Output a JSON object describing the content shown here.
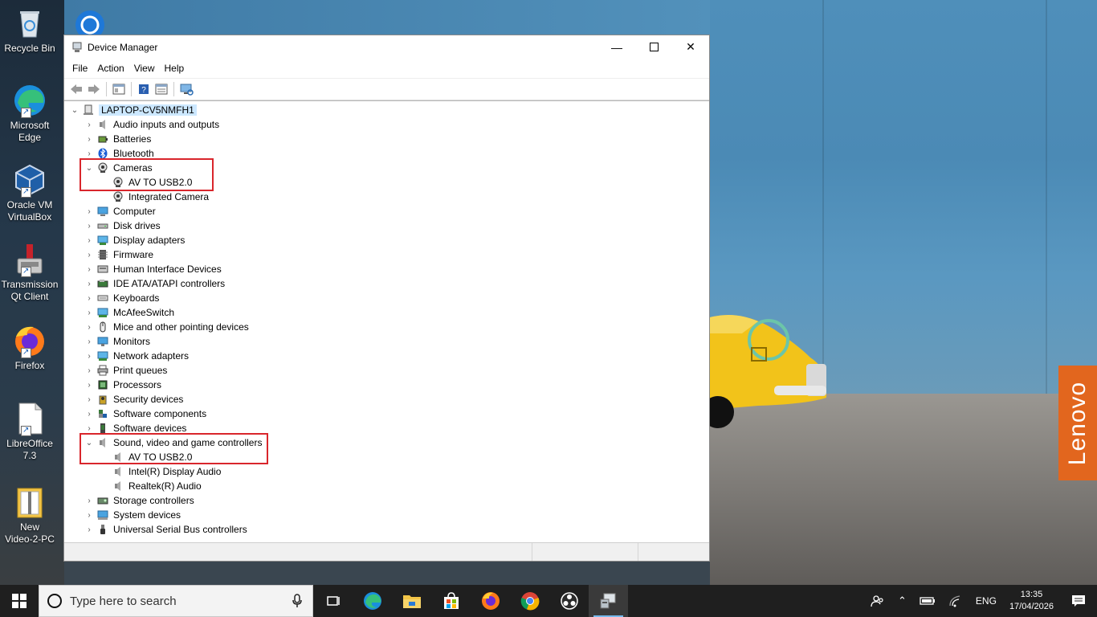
{
  "desktop": {
    "icons": [
      {
        "label_line1": "Recycle Bin",
        "label_line2": ""
      },
      {
        "label_line1": "Microsoft",
        "label_line2": "Edge"
      },
      {
        "label_line1": "Oracle VM",
        "label_line2": "VirtualBox"
      },
      {
        "label_line1": "Transmission",
        "label_line2": "Qt Client"
      },
      {
        "label_line1": "Firefox",
        "label_line2": ""
      },
      {
        "label_line1": "LibreOffice",
        "label_line2": "7.3"
      },
      {
        "label_line1": "New",
        "label_line2": "Video-2-PC"
      }
    ],
    "brand_label": "Lenovo"
  },
  "window": {
    "title": "Device Manager",
    "menu": [
      "File",
      "Action",
      "View",
      "Help"
    ],
    "tree": {
      "root": "LAPTOP-CV5NMFH1",
      "categories": [
        {
          "label": "Audio inputs and outputs",
          "icon": "speaker-icon",
          "expanded": false
        },
        {
          "label": "Batteries",
          "icon": "battery-icon",
          "expanded": false
        },
        {
          "label": "Bluetooth",
          "icon": "bluetooth-icon",
          "expanded": false
        },
        {
          "label": "Cameras",
          "icon": "camera-icon",
          "expanded": true,
          "children": [
            "AV TO USB2.0",
            "Integrated Camera"
          ]
        },
        {
          "label": "Computer",
          "icon": "computer-icon",
          "expanded": false
        },
        {
          "label": "Disk drives",
          "icon": "disk-icon",
          "expanded": false
        },
        {
          "label": "Display adapters",
          "icon": "display-adapter-icon",
          "expanded": false
        },
        {
          "label": "Firmware",
          "icon": "firmware-icon",
          "expanded": false
        },
        {
          "label": "Human Interface Devices",
          "icon": "hid-icon",
          "expanded": false
        },
        {
          "label": "IDE ATA/ATAPI controllers",
          "icon": "ide-icon",
          "expanded": false
        },
        {
          "label": "Keyboards",
          "icon": "keyboard-icon",
          "expanded": false
        },
        {
          "label": "McAfeeSwitch",
          "icon": "network-icon",
          "expanded": false
        },
        {
          "label": "Mice and other pointing devices",
          "icon": "mouse-icon",
          "expanded": false
        },
        {
          "label": "Monitors",
          "icon": "monitor-icon",
          "expanded": false
        },
        {
          "label": "Network adapters",
          "icon": "network-icon",
          "expanded": false
        },
        {
          "label": "Print queues",
          "icon": "printer-icon",
          "expanded": false
        },
        {
          "label": "Processors",
          "icon": "processor-icon",
          "expanded": false
        },
        {
          "label": "Security devices",
          "icon": "security-icon",
          "expanded": false
        },
        {
          "label": "Software components",
          "icon": "software-component-icon",
          "expanded": false
        },
        {
          "label": "Software devices",
          "icon": "software-device-icon",
          "expanded": false
        },
        {
          "label": "Sound, video and game controllers",
          "icon": "speaker-icon",
          "expanded": true,
          "children": [
            "AV TO USB2.0",
            "Intel(R) Display Audio",
            "Realtek(R) Audio"
          ]
        },
        {
          "label": "Storage controllers",
          "icon": "storage-icon",
          "expanded": false
        },
        {
          "label": "System devices",
          "icon": "system-icon",
          "expanded": false
        },
        {
          "label": "Universal Serial Bus controllers",
          "icon": "usb-icon",
          "expanded": false
        }
      ]
    },
    "highlight_color": "#d9262c"
  },
  "taskbar": {
    "search_placeholder": "Type here to search",
    "language": "ENG",
    "time": "13:35",
    "date": "17/04/2026"
  }
}
